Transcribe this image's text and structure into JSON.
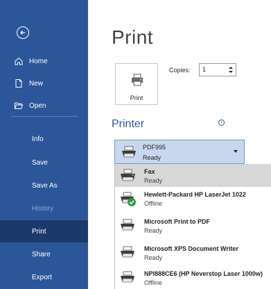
{
  "sidebar": {
    "back_icon": "back-arrow-circle-icon",
    "items": [
      {
        "label": "Home",
        "icon": "home-icon"
      },
      {
        "label": "New",
        "icon": "new-document-icon"
      },
      {
        "label": "Open",
        "icon": "folder-open-icon"
      },
      {
        "label": "Info"
      },
      {
        "label": "Save"
      },
      {
        "label": "Save As"
      },
      {
        "label": "History",
        "state": "disabled"
      },
      {
        "label": "Print",
        "state": "selected"
      },
      {
        "label": "Share"
      },
      {
        "label": "Export"
      }
    ],
    "colors": {
      "background": "#2b579a",
      "selected": "#1b3a6b"
    }
  },
  "main": {
    "title": "Print",
    "print_button": {
      "label": "Print",
      "icon": "printer-icon"
    },
    "copies": {
      "label": "Copies:",
      "value": "1"
    },
    "printer_section": {
      "title": "Printer",
      "info_icon": "info-icon",
      "selected": {
        "name": "PDF995",
        "status": "Ready"
      },
      "options": [
        {
          "name": "Fax",
          "status": "Ready",
          "icon": "fax-printer-icon",
          "highlighted": true
        },
        {
          "name": "Hewlett-Packard HP LaserJet 1022",
          "status": "Offline",
          "icon": "default-printer-check-icon"
        },
        {
          "name": "Microsoft Print to PDF",
          "status": "Ready",
          "icon": "printer-icon"
        },
        {
          "name": "Microsoft XPS Document Writer",
          "status": "Ready",
          "icon": "printer-icon"
        },
        {
          "name": "NPI888CE6 (HP Neverstop Laser 1000w)",
          "status": "Offline",
          "icon": "printer-icon"
        }
      ]
    }
  }
}
